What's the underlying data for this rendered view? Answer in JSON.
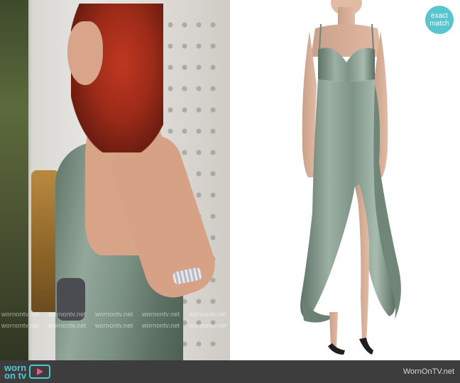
{
  "badge": {
    "line1": "exact",
    "line2": "match"
  },
  "watermark": {
    "text": "wornontv.net"
  },
  "footer": {
    "logo_top": "worn",
    "logo_bottom": "on tv",
    "site": "WornOnTV.net"
  },
  "colors": {
    "accent": "#58c5cf",
    "dress": "#7d9486",
    "footer_bg": "#3d3d3d",
    "play_pink": "#e25d8f"
  }
}
